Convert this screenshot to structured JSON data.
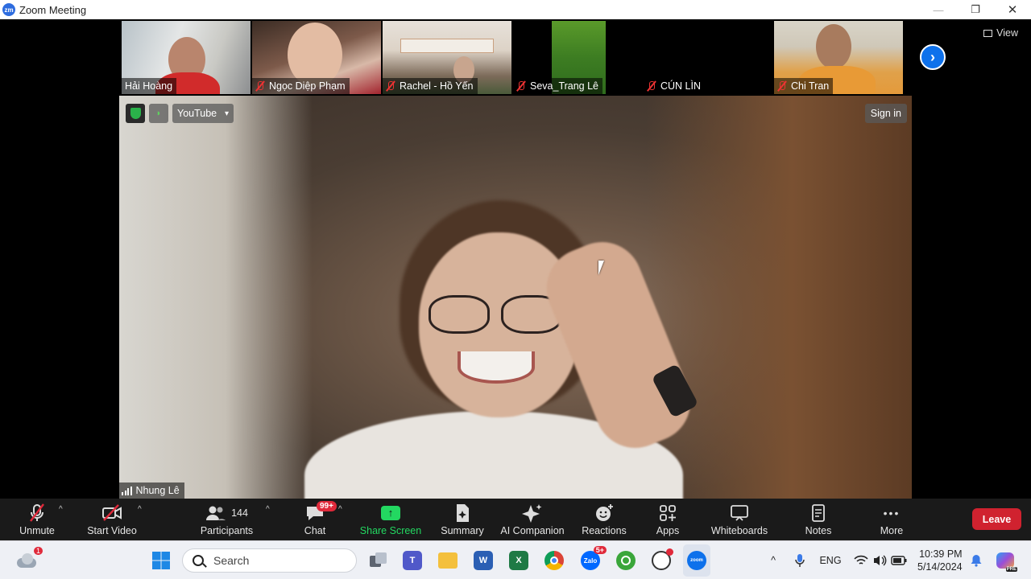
{
  "window": {
    "logo": "zm",
    "title": "Zoom Meeting"
  },
  "window_controls": {
    "minimize": "—",
    "maximize": "❐",
    "close": "✕"
  },
  "participants_strip": [
    {
      "name": "Hải Hoàng",
      "muted": false
    },
    {
      "name": "Ngọc Diệp Phạm",
      "muted": true
    },
    {
      "name": "Rachel - Hồ Yến",
      "muted": true
    },
    {
      "name": "Seva_Trang Lê",
      "muted": true
    },
    {
      "name": "CÚN LÌN",
      "muted": true
    },
    {
      "name": "Chi Tran",
      "muted": true
    }
  ],
  "strip_next_icon": "›",
  "view_button": {
    "label": "View"
  },
  "speaker": {
    "name": "Nhung Lê",
    "yt_chip": {
      "label": "YouTube",
      "caret": "▾"
    },
    "rss_glyph": "◗",
    "signin_label": "Sign in"
  },
  "toolbar": {
    "unmute": "Unmute",
    "start_video": "Start Video",
    "participants": "Participants",
    "participant_count": "144",
    "chat": "Chat",
    "chat_badge": "99+",
    "share_screen": "Share Screen",
    "share_arrow": "↑",
    "summary": "Summary",
    "ai_companion": "AI Companion",
    "reactions": "Reactions",
    "apps": "Apps",
    "whiteboards": "Whiteboards",
    "notes": "Notes",
    "more": "More",
    "more_glyph": "•••",
    "leave": "Leave",
    "caret": "^"
  },
  "taskbar": {
    "weather_badge": "1",
    "search_placeholder": "Search",
    "teams_letter": "T",
    "word_letter": "W",
    "excel_letter": "X",
    "zalo_label": "Zalo",
    "zalo_badge": "5+",
    "zoom_label": "zoom",
    "tray_chevron": "^",
    "lang": "ENG",
    "time": "10:39 PM",
    "date": "5/14/2024",
    "copilot_tag": "PRE"
  },
  "colors": {
    "zoom_blue": "#0e71eb",
    "leave_red": "#d0222f",
    "share_green": "#23d861",
    "badge_red": "#e0293a"
  }
}
